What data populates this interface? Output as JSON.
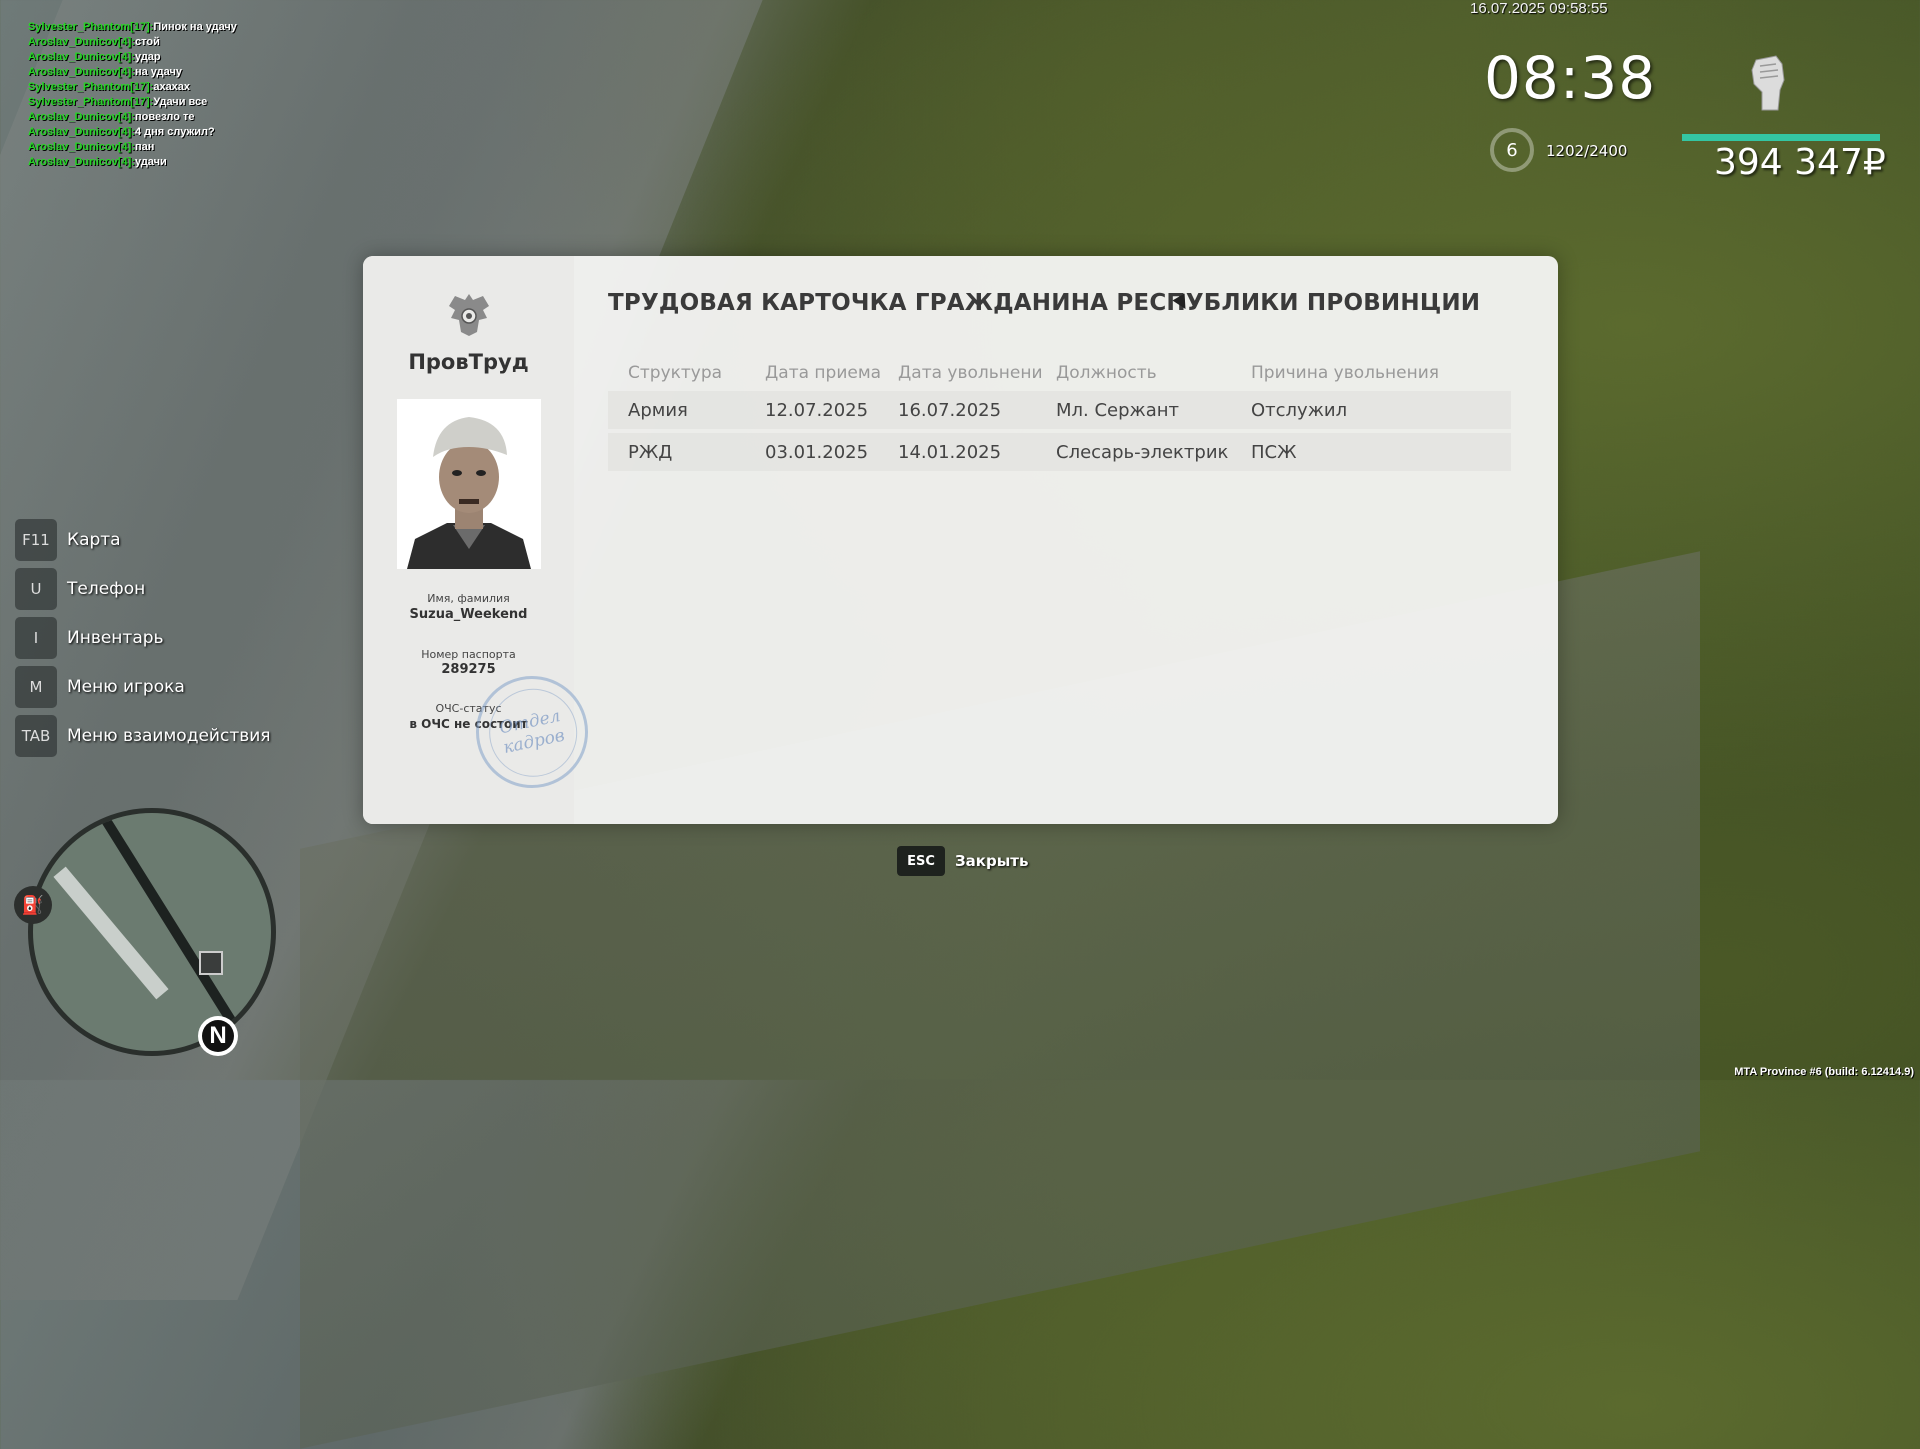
{
  "chat": [
    {
      "nick": "Sylvester_Phantom[17]:",
      "msg": "Пинок на удачу"
    },
    {
      "nick": "Aroslav_Dunicov[4]:",
      "msg": "стой"
    },
    {
      "nick": "Aroslav_Dunicov[4]:",
      "msg": "удар"
    },
    {
      "nick": "Aroslav_Dunicov[4]:",
      "msg": "на удачу"
    },
    {
      "nick": "Sylvester_Phantom[17]:",
      "msg": "ахахах"
    },
    {
      "nick": "Sylvester_Phantom[17]:",
      "msg": "Удачи все"
    },
    {
      "nick": "Aroslav_Dunicov[4]:",
      "msg": "повезло те"
    },
    {
      "nick": "Aroslav_Dunicov[4]:",
      "msg": "4 дня служил?"
    },
    {
      "nick": "Aroslav_Dunicov[4]:",
      "msg": "пан"
    },
    {
      "nick": "Aroslav_Dunicov[4]:",
      "msg": "удачи"
    }
  ],
  "hud": {
    "datetime": "16.07.2025 09:58:55",
    "clock": "08:38",
    "level": "6",
    "xp": "1202/2400",
    "money": "394 347₽",
    "money_bar_color": "#34c6a3",
    "fist_icon": "fist-icon"
  },
  "menu": [
    {
      "key": "F11",
      "label": "Карта"
    },
    {
      "key": "U",
      "label": "Телефон"
    },
    {
      "key": "I",
      "label": "Инвентарь"
    },
    {
      "key": "M",
      "label": "Меню игрока"
    },
    {
      "key": "TAB",
      "label": "Меню взаимодействия"
    }
  ],
  "minimap": {
    "north": "N"
  },
  "card": {
    "org": "ПровТруд",
    "title": "ТРУДОВАЯ КАРТОЧКА ГРАЖДАНИНА РЕСПУБЛИКИ ПРОВИНЦИИ",
    "name_label": "Имя, фамилия",
    "name": "Suzua_Weekend",
    "passport_label": "Номер паспорта",
    "passport": "289275",
    "ochs_label": "ОЧС-статус",
    "ochs": "в ОЧС не состоит",
    "stamp_line1": "Отдел",
    "stamp_line2": "кадров",
    "columns": [
      "Структура",
      "Дата приема",
      "Дата увольнени",
      "Должность",
      "Причина увольнения"
    ],
    "rows": [
      [
        "Армия",
        "12.07.2025",
        "16.07.2025",
        "Мл. Сержант",
        "Отслужил"
      ],
      [
        "РЖД",
        "03.01.2025",
        "14.01.2025",
        "Слесарь-электрик",
        "ПСЖ"
      ]
    ]
  },
  "close": {
    "key": "ESC",
    "label": "Закрыть"
  },
  "build": "MTA Province #6 (build: 6.12414.9)"
}
